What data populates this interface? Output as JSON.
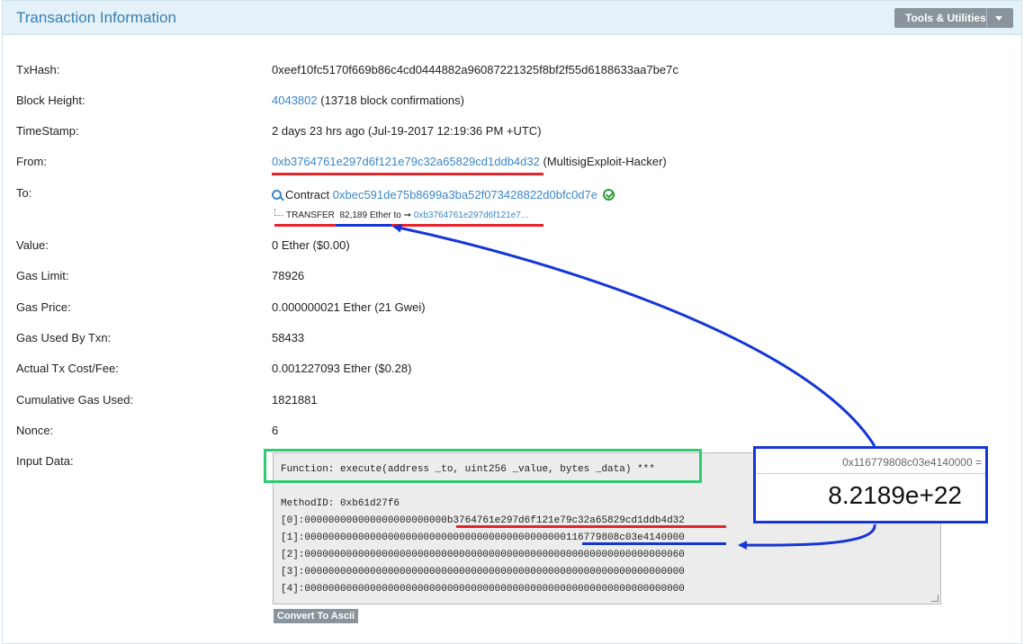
{
  "header": {
    "title": "Transaction Information",
    "tools_label": "Tools & Utilities"
  },
  "fields": {
    "txhash": {
      "label": "TxHash:",
      "value": "0xeef10fc5170f669b86c4cd0444882a96087221325f8bf2f55d6188633aa7be7c"
    },
    "block_height": {
      "label": "Block Height:",
      "block": "4043802",
      "confirmations": "(13718 block confirmations)"
    },
    "timestamp": {
      "label": "TimeStamp:",
      "value": "2 days 23 hrs ago (Jul-19-2017 12:19:36 PM +UTC)"
    },
    "from": {
      "label": "From:",
      "address": "0xb3764761e297d6f121e79c32a65829cd1ddb4d32",
      "tag": "(MultisigExploit-Hacker)"
    },
    "to": {
      "label": "To:",
      "contract_prefix": "Contract",
      "address": "0xbec591de75b8699a3ba52f073428822d0bfc0d7e",
      "transfer_label": "TRANSFER",
      "transfer_amount": "82,189 Ether",
      "transfer_to": "to",
      "transfer_arrow": "➞",
      "transfer_address": "0xb3764761e297d6f121e7..."
    },
    "value": {
      "label": "Value:",
      "value": "0 Ether ($0.00)"
    },
    "gas_limit": {
      "label": "Gas Limit:",
      "value": "78926"
    },
    "gas_price": {
      "label": "Gas Price:",
      "value": "0.000000021 Ether (21 Gwei)"
    },
    "gas_used": {
      "label": "Gas Used By Txn:",
      "value": "58433"
    },
    "tx_cost": {
      "label": "Actual Tx Cost/Fee:",
      "value": "0.001227093 Ether ($0.28)"
    },
    "cumulative_gas": {
      "label": "Cumulative Gas Used:",
      "value": "1821881"
    },
    "nonce": {
      "label": "Nonce:",
      "value": "6"
    },
    "input_data": {
      "label": "Input Data:"
    }
  },
  "input_data": {
    "function": "Function: execute(address _to, uint256 _value, bytes _data) ***",
    "method_id": "MethodID: 0xb61d27f6",
    "params": [
      "[0]:000000000000000000000000b3764761e297d6f121e79c32a65829cd1ddb4d32",
      "[1]:00000000000000000000000000000000000000000000116779808c03e4140000",
      "[2]:0000000000000000000000000000000000000000000000000000000000000060",
      "[3]:0000000000000000000000000000000000000000000000000000000000000000",
      "[4]:0000000000000000000000000000000000000000000000000000000000000000"
    ],
    "convert_button": "Convert To Ascii"
  },
  "calculator": {
    "expression": "0x116779808c03e4140000 =",
    "result": "8.2189e+22"
  },
  "colors": {
    "link": "#3a87c8",
    "highlight_red": "#e8232b",
    "highlight_blue": "#1536d6",
    "highlight_green": "#2ecc71",
    "header_bg": "#e4f1f8"
  }
}
